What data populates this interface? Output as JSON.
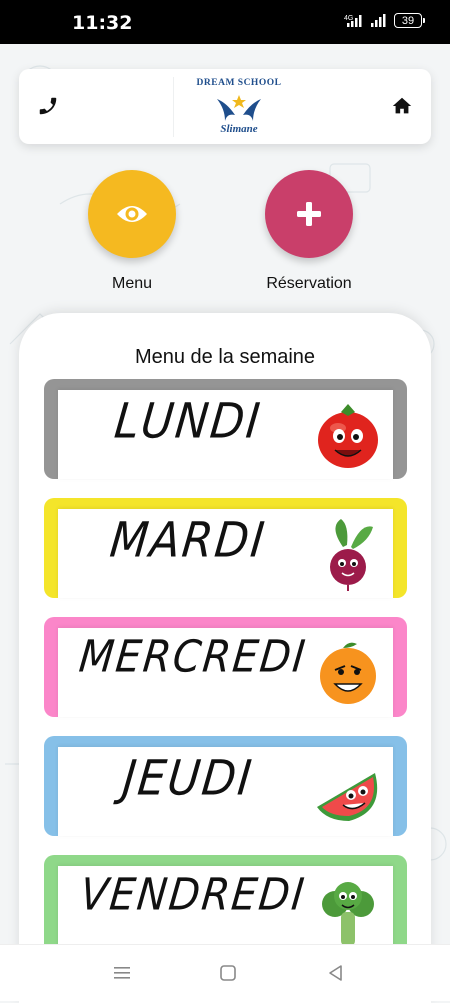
{
  "status_bar": {
    "time": "11:32",
    "network": "4G",
    "battery": "39"
  },
  "header": {
    "logo_title": "DREAM SCHOOL",
    "logo_subtitle": "Slimane",
    "phone_icon": "phone-icon",
    "home_icon": "home-icon"
  },
  "actions": [
    {
      "label": "Menu",
      "icon": "eye-icon",
      "color": "#f5b920"
    },
    {
      "label": "Réservation",
      "icon": "plus-icon",
      "color": "#c93f6a"
    }
  ],
  "panel": {
    "title": "Menu de la semaine",
    "days": [
      {
        "name": "LUNDI",
        "border_color": "#959595",
        "emoji": "tomato"
      },
      {
        "name": "MARDI",
        "border_color": "#f4e52a",
        "emoji": "beet"
      },
      {
        "name": "MERCREDI",
        "border_color": "#fb86c9",
        "emoji": "orange"
      },
      {
        "name": "JEUDI",
        "border_color": "#86c0e8",
        "emoji": "watermelon"
      },
      {
        "name": "VENDREDI",
        "border_color": "#8fd889",
        "emoji": "broccoli"
      }
    ]
  },
  "nav": {
    "menu_icon": "menu-icon",
    "home_icon": "square-icon",
    "back_icon": "back-triangle-icon"
  }
}
